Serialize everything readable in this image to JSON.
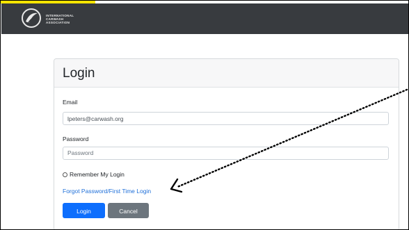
{
  "header": {
    "logo_lines": [
      "INTERNATIONAL",
      "CARWASH",
      "ASSOCIATION"
    ]
  },
  "login": {
    "title": "Login",
    "email_label": "Email",
    "email_value": "lpeters@carwash.org",
    "password_label": "Password",
    "password_placeholder": "Password",
    "remember_label": "Remember My Login",
    "forgot_link": "Forgot Password/First Time Login",
    "login_button": "Login",
    "cancel_button": "Cancel"
  },
  "colors": {
    "topbar": "#383b3f",
    "primary": "#0d6efd",
    "secondary": "#6c757d",
    "link": "#1e6fd9",
    "highlight": "#f5e400"
  }
}
